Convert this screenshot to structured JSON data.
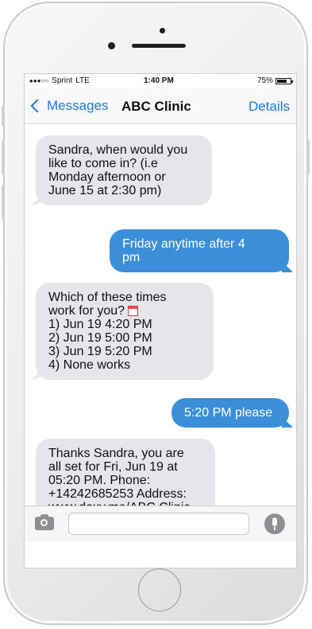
{
  "status_bar": {
    "carrier": "Sprint",
    "network": "LTE",
    "time": "1:40 PM",
    "battery_percent": "75%",
    "battery_level": 0.75,
    "signal_bars": 3
  },
  "nav": {
    "back_label": "Messages",
    "title": "ABC Clinic",
    "details_label": "Details"
  },
  "messages": [
    {
      "direction": "incoming",
      "lines": [
        "Sandra, when would you",
        "like to come in? (i.e",
        "Monday afternoon or",
        "June 15 at 2:30 pm)"
      ]
    },
    {
      "direction": "outgoing",
      "lines": [
        "Friday anytime after 4",
        "pm"
      ]
    },
    {
      "direction": "incoming",
      "lines": [
        "Which of these times",
        "work for you?",
        "1) Jun 19 4:20 PM",
        "2) Jun 19 5:00 PM",
        "3) Jun 19 5:20 PM",
        "4) None works"
      ],
      "icon": "calendar-icon"
    },
    {
      "direction": "outgoing",
      "lines": [
        "5:20 PM please"
      ]
    },
    {
      "direction": "incoming",
      "lines": [
        "Thanks Sandra, you are",
        "all set for Fri, Jun 19 at",
        "05:20 PM. Phone:",
        "+14242685253 Address:",
        "www.doxy.me/ABC Clinic"
      ]
    }
  ],
  "input_bar": {
    "camera_icon": "camera-icon",
    "microphone_icon": "microphone-icon"
  },
  "colors": {
    "accent": "#1f7ae0",
    "outgoing_bubble": "#3b8fd8",
    "incoming_bubble": "#e5e5ea"
  }
}
